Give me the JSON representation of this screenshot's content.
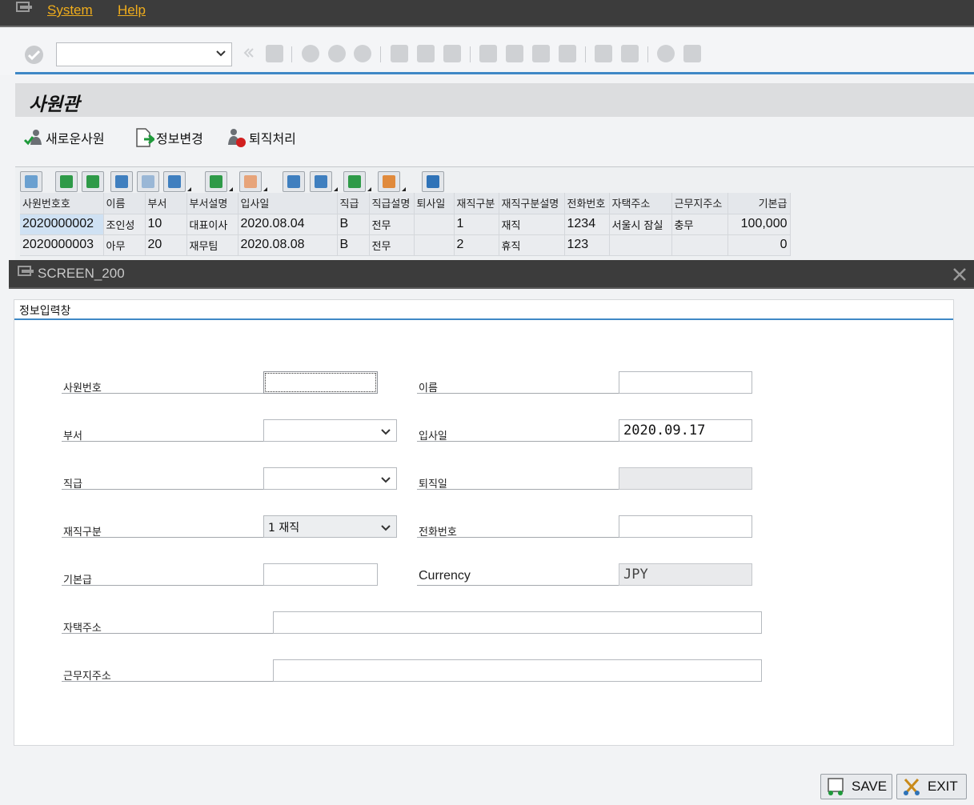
{
  "menubar": {
    "items": [
      {
        "label": "System"
      },
      {
        "label": "Help"
      }
    ]
  },
  "toolbar": {
    "command_field": {
      "value": "",
      "placeholder": ""
    }
  },
  "screen": {
    "title": "사원관"
  },
  "app_toolbar": {
    "new_employee": "새로운사원",
    "change_info": "정보변경",
    "retire": "퇴직처리"
  },
  "alv": {
    "columns": [
      "사원번호호",
      "이름",
      "부서",
      "부서설명",
      "입사일",
      "직급",
      "직급설명",
      "퇴사일",
      "재직구분",
      "재직구분설명",
      "전화번호",
      "자택주소",
      "근무지주소",
      "기본급"
    ],
    "rows": [
      [
        "2020000002",
        "조인성",
        "10",
        "대표이사",
        "2020.08.04",
        "B",
        "전무",
        "",
        "1",
        "재직",
        "1234",
        "서울시 잠실",
        "충무",
        "100,000"
      ],
      [
        "2020000003",
        "아무",
        "20",
        "재무팀",
        "2020.08.08",
        "B",
        "전무",
        "",
        "2",
        "휴직",
        "123",
        "",
        "",
        "0"
      ]
    ]
  },
  "dialog": {
    "title": "SCREEN_200",
    "group_title": "정보입력창",
    "fields": {
      "emp_no": {
        "label": "사원번호",
        "value": ""
      },
      "name": {
        "label": "이름",
        "value": ""
      },
      "dept": {
        "label": "부서",
        "value": ""
      },
      "hire_date": {
        "label": "입사일",
        "value": "2020.09.17"
      },
      "rank": {
        "label": "직급",
        "value": ""
      },
      "retire_date": {
        "label": "퇴직일",
        "value": ""
      },
      "status": {
        "label": "재직구분",
        "value": "1 재직"
      },
      "phone": {
        "label": "전화번호",
        "value": ""
      },
      "salary": {
        "label": "기본급",
        "value": ""
      },
      "currency": {
        "label": "Currency",
        "value": "JPY"
      },
      "home_addr": {
        "label": "자택주소",
        "value": ""
      },
      "work_addr": {
        "label": "근무지주소",
        "value": ""
      }
    },
    "buttons": {
      "save": "SAVE",
      "exit": "EXIT"
    }
  },
  "colors": {
    "menu_text": "#f0ad1c",
    "accent_rule": "#3f88c6",
    "dark_bar": "#3c3c3c"
  }
}
